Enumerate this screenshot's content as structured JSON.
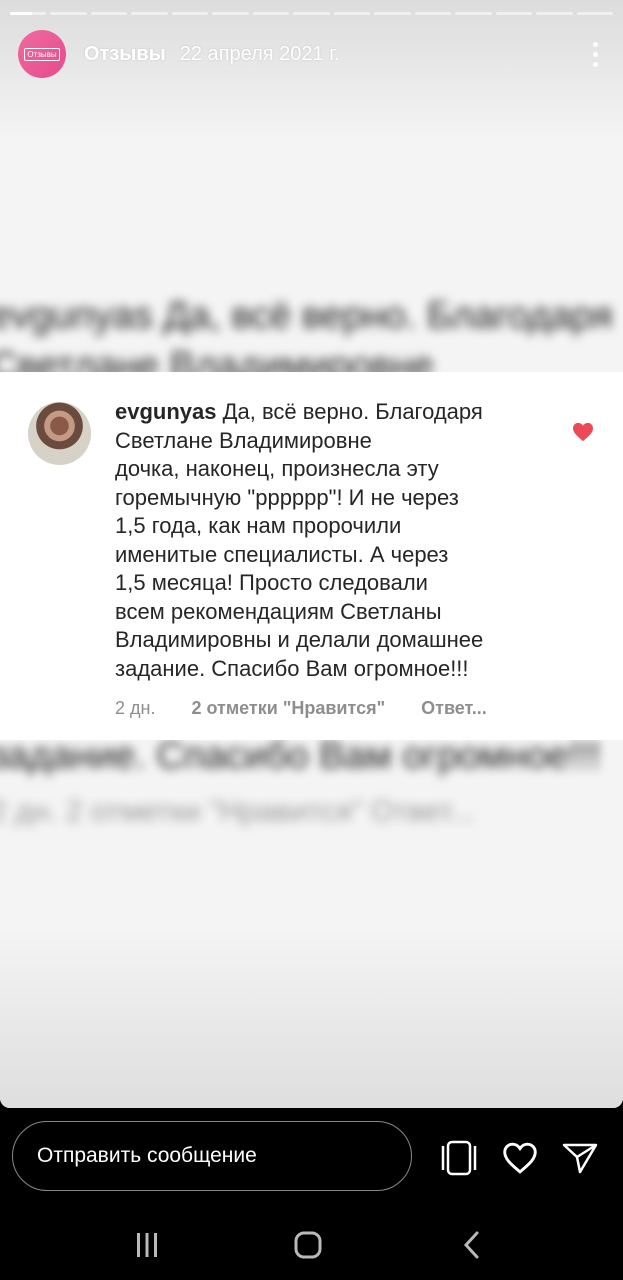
{
  "story": {
    "username": "Отзывы",
    "date": "22 апреля 2021 г.",
    "avatar_badge": "Отзывы",
    "segments_total": 15,
    "segment_progress": 0.6
  },
  "background_blur": {
    "top_line1": "evgunyas Да, всё верно. Благодаря",
    "top_line2": "Светлане Владимировне",
    "bottom_line1": "задание. Спасибо Вам огромное!!!",
    "bottom_line2": "2 дн.     2 отметки \"Нравится\"     Ответ..."
  },
  "comment": {
    "username": "evgunyas",
    "lines": [
      "Да, всё верно. Благодаря",
      "Светлане Владимировне",
      "дочка, наконец, произнесла эту",
      "горемычную \"рррррр\"! И не через",
      "1,5 года, как нам пророчили",
      "именитые специалисты. А через",
      "1,5 месяца! Просто следовали",
      "всем рекомендациям Светланы",
      "Владимировны и делали домашнее",
      "задание. Спасибо Вам огромное!!!"
    ],
    "time": "2 дн.",
    "likes": "2 отметки \"Нравится\"",
    "reply": "Ответ...",
    "liked_color": "#ed4956"
  },
  "bottom": {
    "message_placeholder": "Отправить сообщение",
    "icons": [
      "stickers-icon",
      "heart-icon",
      "send-icon"
    ]
  },
  "navbar": {
    "icons": [
      "recent-apps-icon",
      "home-icon",
      "back-icon"
    ]
  }
}
